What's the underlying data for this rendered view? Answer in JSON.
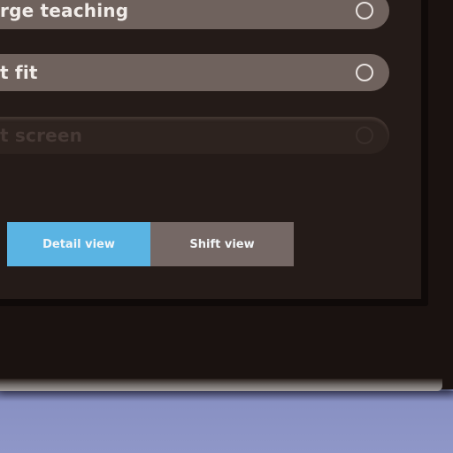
{
  "options": [
    {
      "label": "rge teaching",
      "selected": false
    },
    {
      "label": "t fit",
      "selected": false
    },
    {
      "label": "t screen",
      "selected": false,
      "disabled": true
    }
  ],
  "view_toggle": {
    "detail_label": "Detail view",
    "shift_label": "Shift view",
    "active": "detail",
    "active_color": "#5ab4e3",
    "inactive_color": "#756865"
  }
}
